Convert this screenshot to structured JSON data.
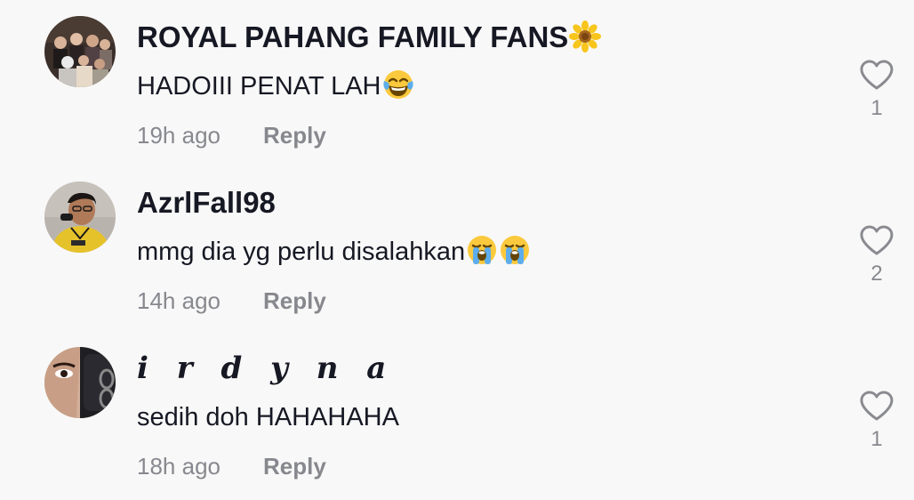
{
  "comments": [
    {
      "username": "ROYAL PAHANG FAMILY FANS",
      "username_emoji": "sunflower-icon",
      "text": "HADOIII PENAT LAH",
      "text_emojis": [
        "tears-of-joy-icon"
      ],
      "time": "19h ago",
      "reply_label": "Reply",
      "like_count": "1"
    },
    {
      "username": "AzrlFall98",
      "text": "mmg dia yg perlu disalahkan",
      "text_emojis": [
        "loudly-crying-icon",
        "loudly-crying-icon"
      ],
      "time": "14h ago",
      "reply_label": "Reply",
      "like_count": "2"
    },
    {
      "username": "i r d y n a",
      "text": "sedih doh HAHAHAHA",
      "time": "18h ago",
      "reply_label": "Reply",
      "like_count": "1"
    }
  ],
  "colors": {
    "background": "#f8f8f8",
    "primary_text": "#161823",
    "secondary_text": "#8a8b91",
    "heart_outline": "#8a8b91"
  }
}
